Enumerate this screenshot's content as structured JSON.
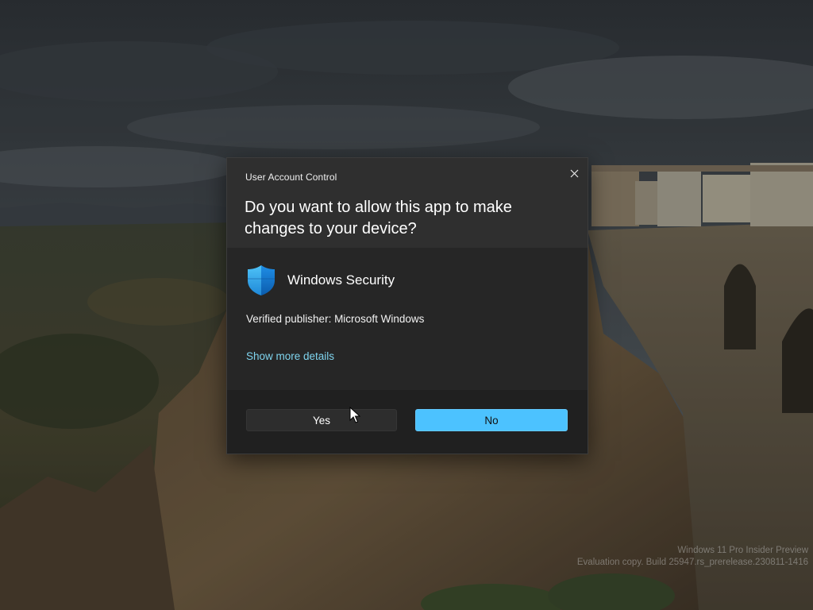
{
  "dialog": {
    "title": "User Account Control",
    "question": "Do you want to allow this app to make changes to your device?",
    "app_name": "Windows Security",
    "app_icon": "windows-security-shield-icon",
    "publisher_text": "Verified publisher: Microsoft Windows",
    "details_link": "Show more details",
    "yes_label": "Yes",
    "no_label": "No",
    "close_icon": "close-icon"
  },
  "watermark": {
    "line1": "Windows 11 Pro Insider Preview",
    "line2": "Evaluation copy. Build 25947.rs_prerelease.230811-1416"
  },
  "colors": {
    "accent": "#4cc2ff",
    "link": "#7fd4ee",
    "dialog_bg": "#2b2b2b",
    "footer_bg": "#202020"
  }
}
